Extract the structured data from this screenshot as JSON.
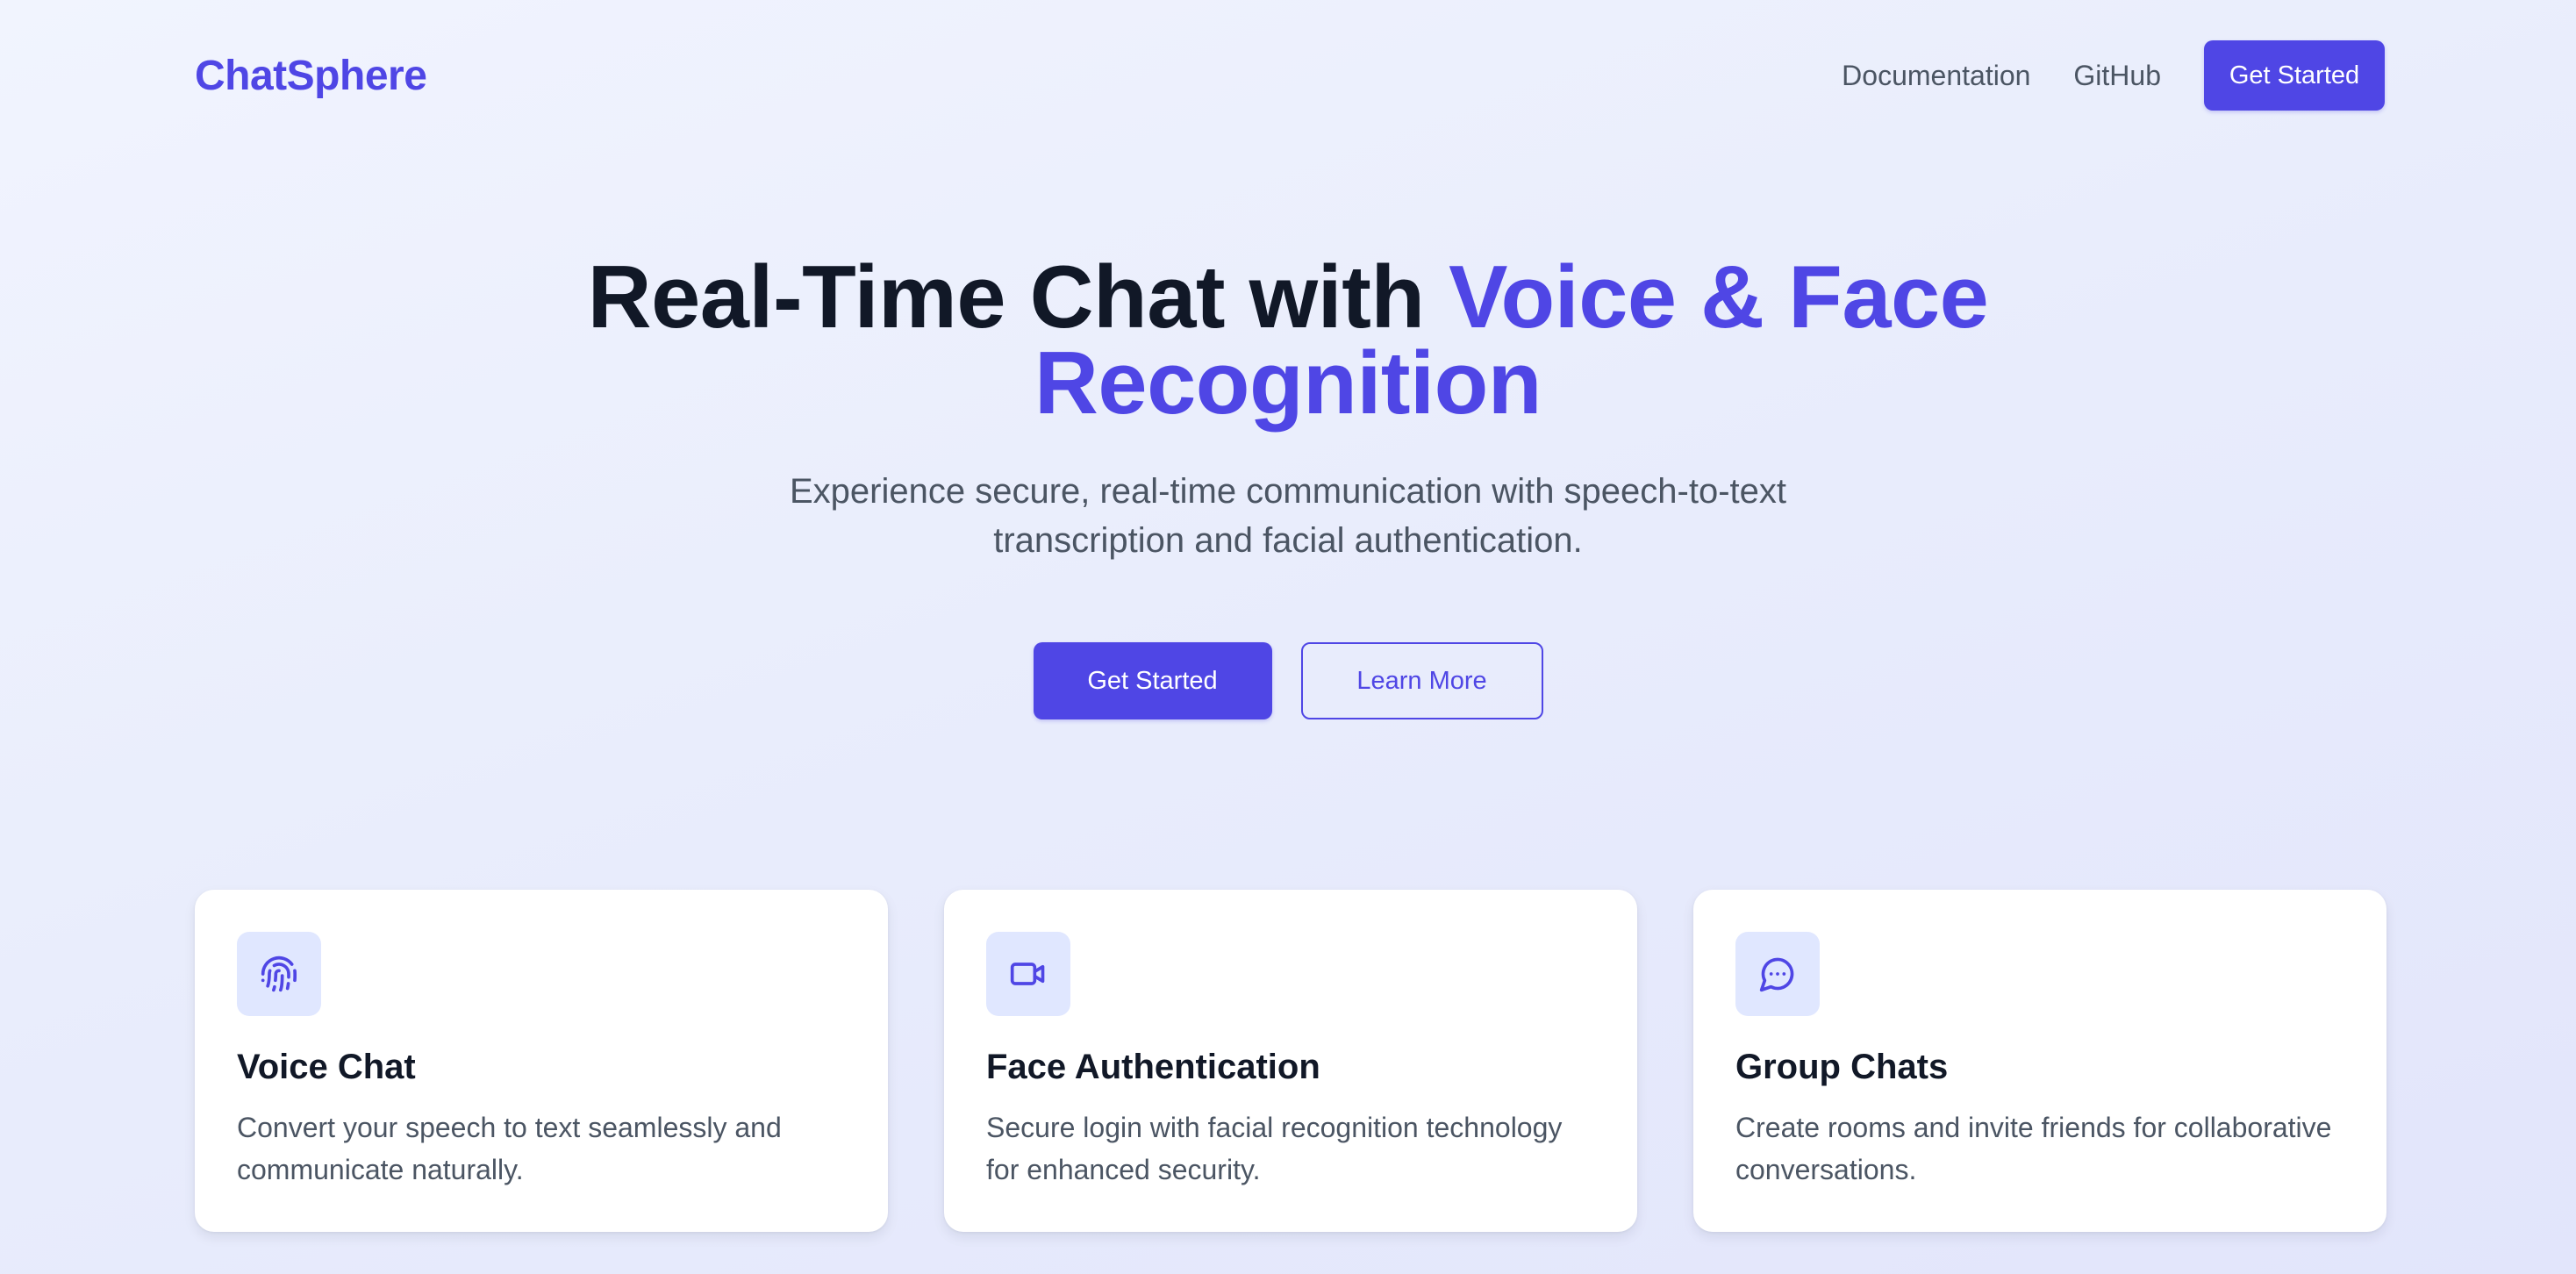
{
  "header": {
    "logo": "ChatSphere",
    "nav": {
      "documentation": "Documentation",
      "github": "GitHub",
      "cta": "Get Started"
    }
  },
  "hero": {
    "title_main": "Real-Time Chat with ",
    "title_accent": "Voice & Face Recognition",
    "subtitle": "Experience secure, real-time communication with speech-to-text transcription and facial authentication.",
    "primary_button": "Get Started",
    "secondary_button": "Learn More"
  },
  "features": [
    {
      "icon": "fingerprint-icon",
      "title": "Voice Chat",
      "description": "Convert your speech to text seamlessly and communicate naturally."
    },
    {
      "icon": "video-camera-icon",
      "title": "Face Authentication",
      "description": "Secure login with facial recognition technology for enhanced security."
    },
    {
      "icon": "chat-bubble-icon",
      "title": "Group Chats",
      "description": "Create rooms and invite friends for collaborative conversations."
    }
  ],
  "colors": {
    "accent": "#4f46e5",
    "icon_bg": "#e0e7ff",
    "text_dark": "#111827",
    "text_muted": "#4b5563"
  }
}
